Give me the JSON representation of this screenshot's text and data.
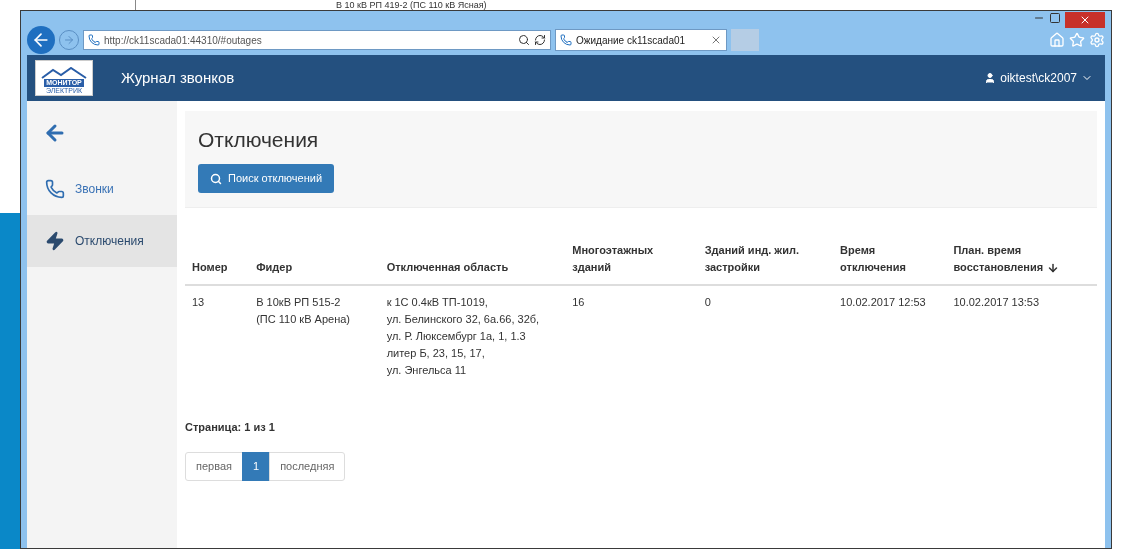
{
  "background": {
    "text": "В 10 кВ РП 419-2 (ПС 110 кВ Ясная)"
  },
  "browser": {
    "address": "http://ck11scada01:44310/#outages",
    "tab": {
      "title": "Ожидание ck11scada01",
      "selected": true
    }
  },
  "navbar": {
    "logo": {
      "name": "МОНИТОР",
      "subtitle": "ЭЛЕКТРИК"
    },
    "title": "Журнал звонков",
    "user": "oiktest\\ck2007"
  },
  "sidebar": {
    "items": [
      {
        "label": "Звонки",
        "kind": "phone",
        "selected": false
      },
      {
        "label": "Отключения",
        "kind": "bolt",
        "selected": true
      }
    ]
  },
  "page": {
    "title": "Отключения",
    "search_button": "Поиск отключений"
  },
  "table": {
    "columns": [
      {
        "label": "Номер",
        "sorted": false
      },
      {
        "label": "Фидер",
        "sorted": false
      },
      {
        "label": "Отключенная область",
        "sorted": false
      },
      {
        "label": "Многоэтажных зданий",
        "sorted": false
      },
      {
        "label": "Зданий инд. жил. застройки",
        "sorted": false
      },
      {
        "label": "Время отключения",
        "sorted": false
      },
      {
        "label": "План. время восстановления",
        "sorted": true
      }
    ],
    "rows": [
      {
        "cells": [
          "13",
          "В 10кВ РП 515-2\n(ПС 110 кВ Арена)",
          "к 1С 0.4кВ ТП-1019,\nул. Белинского 32, 6а.66, 32б,\nул. Р. Люксембург 1а, 1, 1.3\nлитер Б, 23, 15, 17,\nул. Энгельса 11",
          "16",
          "0",
          "10.02.2017 12:53",
          "10.02.2017 13:53"
        ]
      }
    ]
  },
  "pager": {
    "label": "Страница: 1 из 1",
    "items": [
      {
        "label": "первая",
        "selected": false
      },
      {
        "label": "1",
        "selected": true
      },
      {
        "label": "последняя",
        "selected": false
      }
    ]
  }
}
